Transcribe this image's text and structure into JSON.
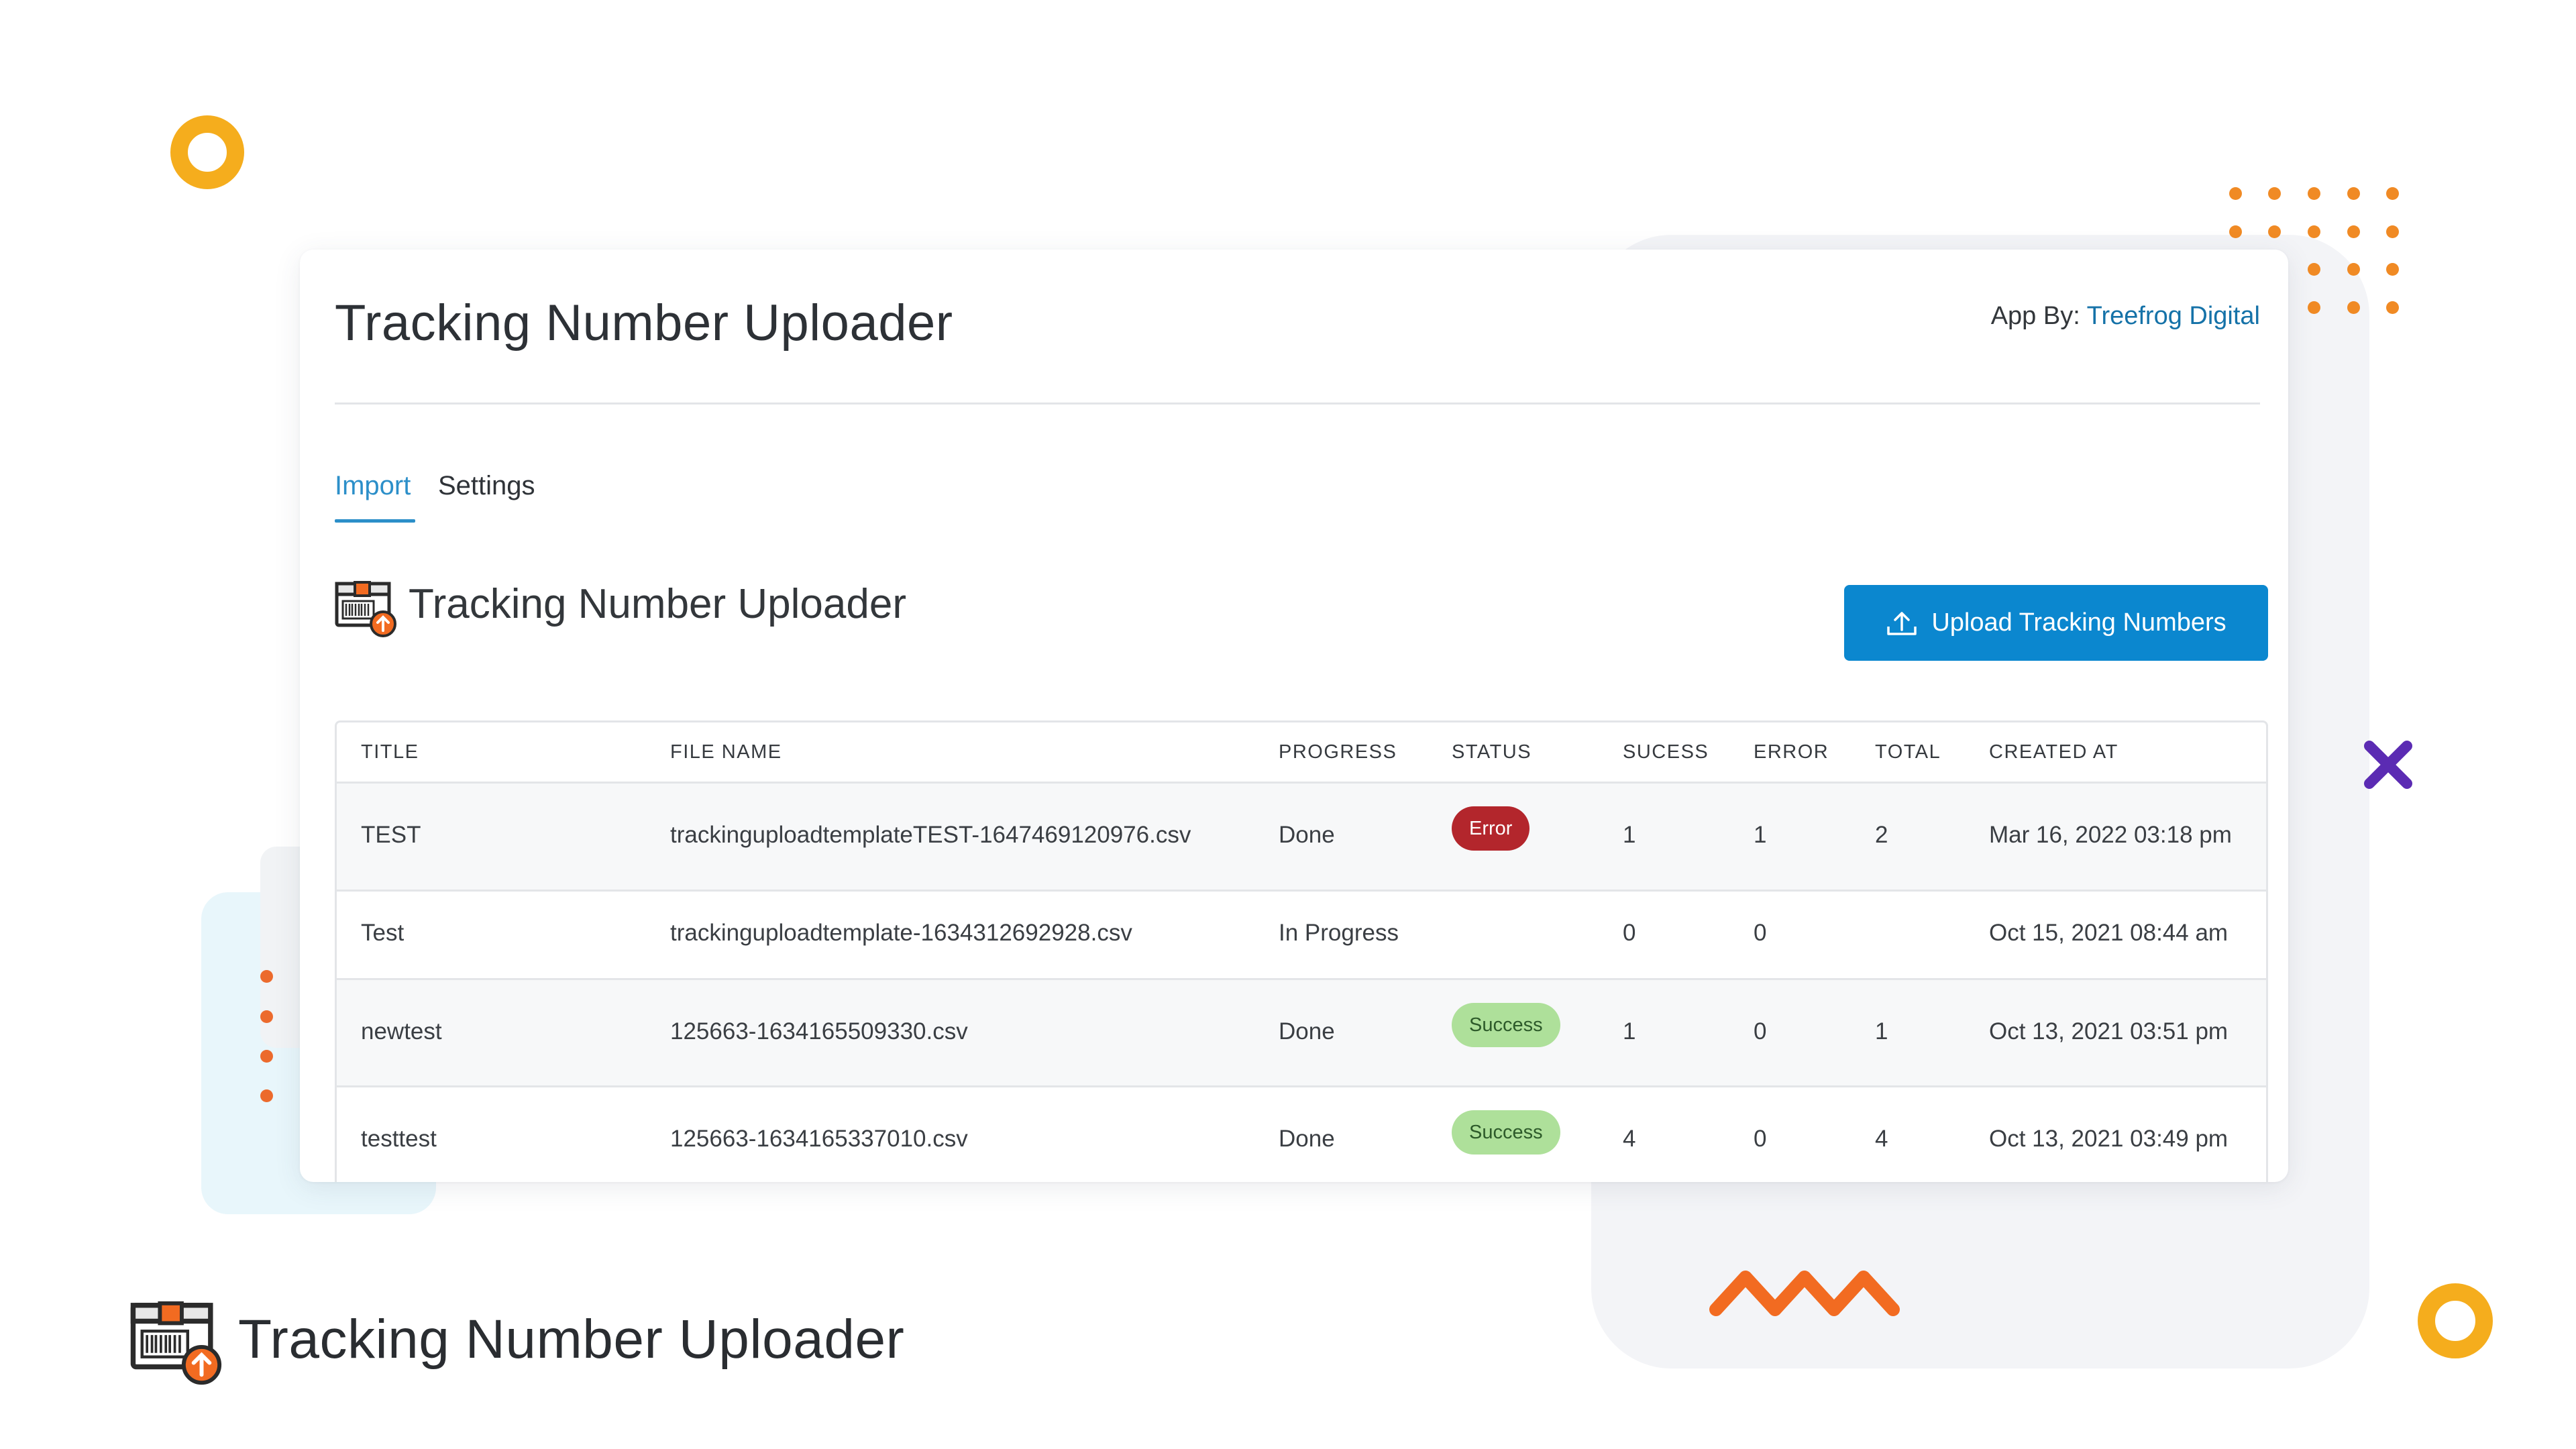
{
  "app": {
    "title": "Tracking Number Uploader",
    "by_label": "App By:",
    "by_link": "Treefrog Digital"
  },
  "tabs": [
    {
      "label": "Import",
      "active": true
    },
    {
      "label": "Settings",
      "active": false
    }
  ],
  "section": {
    "title": "Tracking Number Uploader",
    "icon": "package-upload-icon"
  },
  "upload_button": {
    "label": "Upload Tracking Numbers",
    "icon": "upload-icon"
  },
  "table": {
    "headers": [
      "TITLE",
      "FILE NAME",
      "PROGRESS",
      "STATUS",
      "SUCESS",
      "ERROR",
      "TOTAL",
      "CREATED AT"
    ],
    "rows": [
      {
        "title": "TEST",
        "file_name": "trackinguploadtemplateTEST-1647469120976.csv",
        "progress": "Done",
        "status": "Error",
        "success": "1",
        "error": "1",
        "total": "2",
        "created_at": "Mar 16, 2022 03:18 pm"
      },
      {
        "title": "Test",
        "file_name": "trackinguploadtemplate-1634312692928.csv",
        "progress": "In Progress",
        "status": "",
        "success": "0",
        "error": "0",
        "total": "",
        "created_at": "Oct 15, 2021 08:44 am"
      },
      {
        "title": "newtest",
        "file_name": "125663-1634165509330.csv",
        "progress": "Done",
        "status": "Success",
        "success": "1",
        "error": "0",
        "total": "1",
        "created_at": "Oct 13, 2021 03:51 pm"
      },
      {
        "title": "testtest",
        "file_name": "125663-1634165337010.csv",
        "progress": "Done",
        "status": "Success",
        "success": "4",
        "error": "0",
        "total": "4",
        "created_at": "Oct 13, 2021 03:49 pm"
      }
    ]
  },
  "footer": {
    "title": "Tracking Number Uploader",
    "icon": "package-upload-icon"
  },
  "colors": {
    "accent": "#0b87cf",
    "link": "#1572a8",
    "error_badge": "#b3262c",
    "success_badge": "#aee09a",
    "decor_orange": "#f08a24",
    "decor_yellow": "#f5ad1d",
    "decor_purple": "#5b2bb3"
  }
}
